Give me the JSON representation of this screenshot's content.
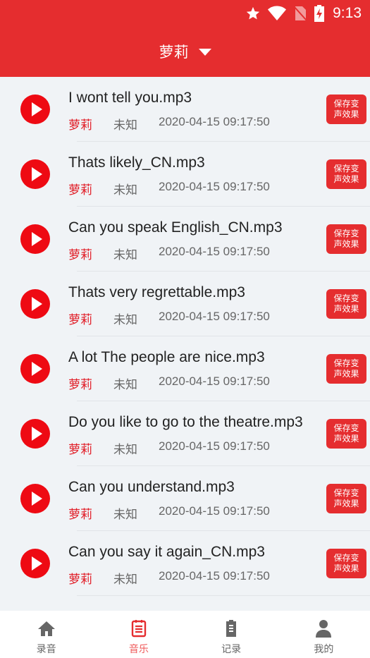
{
  "status_bar": {
    "time": "9:13",
    "icons": [
      "star-icon",
      "wifi-icon",
      "no-sim-icon",
      "battery-charging-icon"
    ]
  },
  "header": {
    "title": "萝莉",
    "dropdown_icon": "caret-down-icon"
  },
  "colors": {
    "brand": "#e52d2f",
    "play": "#ee0a13",
    "artist": "#e11c26",
    "active_tab": "#ef5a5a"
  },
  "tracks": [
    {
      "name": "I wont tell you.mp3",
      "artist": "萝莉",
      "album": "未知",
      "date": "2020-04-15 09:17:50",
      "button": "保存变\n声效果"
    },
    {
      "name": "Thats likely_CN.mp3",
      "artist": "萝莉",
      "album": "未知",
      "date": "2020-04-15 09:17:50",
      "button": "保存变\n声效果"
    },
    {
      "name": "Can you speak English_CN.mp3",
      "artist": "萝莉",
      "album": "未知",
      "date": "2020-04-15 09:17:50",
      "button": "保存变\n声效果"
    },
    {
      "name": "Thats very regrettable.mp3",
      "artist": "萝莉",
      "album": "未知",
      "date": "2020-04-15 09:17:50",
      "button": "保存变\n声效果"
    },
    {
      "name": "A lot The people are nice.mp3",
      "artist": "萝莉",
      "album": "未知",
      "date": "2020-04-15 09:17:50",
      "button": "保存变\n声效果"
    },
    {
      "name": "Do you like to go to the theatre.mp3",
      "artist": "萝莉",
      "album": "未知",
      "date": "2020-04-15 09:17:50",
      "button": "保存变\n声效果"
    },
    {
      "name": "Can you understand.mp3",
      "artist": "萝莉",
      "album": "未知",
      "date": "2020-04-15 09:17:50",
      "button": "保存变\n声效果"
    },
    {
      "name": "Can you say it again_CN.mp3",
      "artist": "萝莉",
      "album": "未知",
      "date": "2020-04-15 09:17:50",
      "button": "保存变\n声效果"
    }
  ],
  "save_button_lines": [
    "保存变",
    "声效果"
  ],
  "tabs": [
    {
      "label": "录音",
      "icon": "home-icon",
      "active": false
    },
    {
      "label": "音乐",
      "icon": "notepad-icon",
      "active": true
    },
    {
      "label": "记录",
      "icon": "clipboard-icon",
      "active": false
    },
    {
      "label": "我的",
      "icon": "person-icon",
      "active": false
    }
  ]
}
